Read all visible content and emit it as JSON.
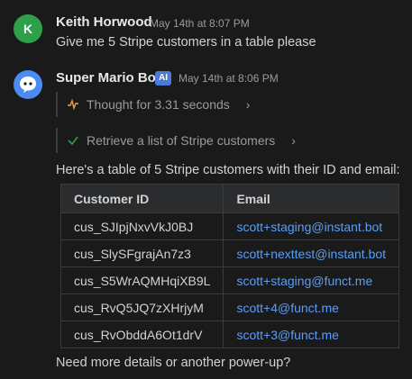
{
  "user_message": {
    "avatar_letter": "K",
    "author": "Keith Horwood",
    "timestamp": "May 14th at 8:07 PM",
    "text": "Give me 5 Stripe customers in a table please"
  },
  "bot_message": {
    "author": "Super Mario Bot",
    "badge": "AI",
    "timestamp": "May 14th at 8:06 PM",
    "steps": [
      {
        "icon": "activity-icon",
        "label": "Thought for 3.31 seconds"
      },
      {
        "icon": "check-icon",
        "label": "Retrieve a list of Stripe customers"
      }
    ],
    "intro": "Here's a table of 5 Stripe customers with their ID and email:",
    "table": {
      "headers": [
        "Customer ID",
        "Email"
      ],
      "rows": [
        [
          "cus_SJIpjNxvVkJ0BJ",
          "scott+staging@instant.bot"
        ],
        [
          "cus_SlySFgrajAn7z3",
          "scott+nexttest@instant.bot"
        ],
        [
          "cus_S5WrAQMHqiXB9L",
          "scott+staging@funct.me"
        ],
        [
          "cus_RvQ5JQ7zXHrjyM",
          "scott+4@funct.me"
        ],
        [
          "cus_RvObddA6Ot1drV",
          "scott+3@funct.me"
        ]
      ]
    },
    "outro": "Need more details or another power-up?"
  },
  "colors": {
    "background": "#1a1a1b",
    "link": "#5b9ef5",
    "user_avatar": "#2ea04a",
    "bot_avatar": "#4a8cf0",
    "badge": "#4a7bd8",
    "check": "#2ea04a",
    "thought": "#e8a33a"
  }
}
